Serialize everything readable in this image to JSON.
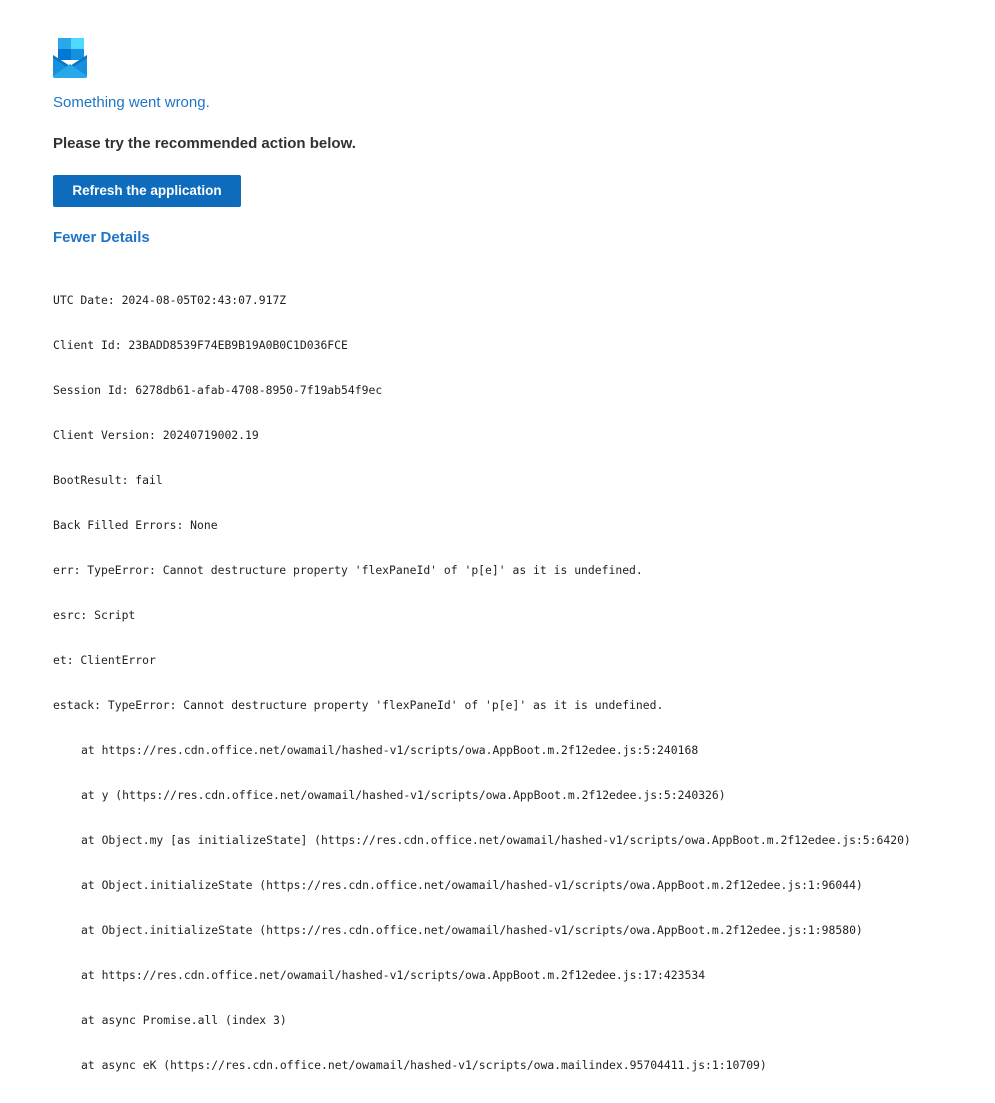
{
  "logo": {
    "icon": "outlook-envelope-icon"
  },
  "headline": "Something went wrong.",
  "subhead": "Please try the recommended action below.",
  "refresh_button": "Refresh the application",
  "details_toggle": "Fewer Details",
  "details": {
    "utc_date": "UTC Date: 2024-08-05T02:43:07.917Z",
    "client_id": "Client Id: 23BADD8539F74EB9B19A0B0C1D036FCE",
    "session_id": "Session Id: 6278db61-afab-4708-8950-7f19ab54f9ec",
    "client_version": "Client Version: 20240719002.19",
    "boot_result": "BootResult: fail",
    "back_filled_errors": "Back Filled Errors: None",
    "err": "err: TypeError: Cannot destructure property 'flexPaneId' of 'p[e]' as it is undefined.",
    "esrc": "esrc: Script",
    "et": "et: ClientError",
    "estack": "estack: TypeError: Cannot destructure property 'flexPaneId' of 'p[e]' as it is undefined.",
    "stack": [
      "at https://res.cdn.office.net/owamail/hashed-v1/scripts/owa.AppBoot.m.2f12edee.js:5:240168",
      "at y (https://res.cdn.office.net/owamail/hashed-v1/scripts/owa.AppBoot.m.2f12edee.js:5:240326)",
      "at Object.my [as initializeState] (https://res.cdn.office.net/owamail/hashed-v1/scripts/owa.AppBoot.m.2f12edee.js:5:6420)",
      "at Object.initializeState (https://res.cdn.office.net/owamail/hashed-v1/scripts/owa.AppBoot.m.2f12edee.js:1:96044)",
      "at Object.initializeState (https://res.cdn.office.net/owamail/hashed-v1/scripts/owa.AppBoot.m.2f12edee.js:1:98580)",
      "at https://res.cdn.office.net/owamail/hashed-v1/scripts/owa.AppBoot.m.2f12edee.js:17:423534",
      "at async Promise.all (index 3)",
      "at async eK (https://res.cdn.office.net/owamail/hashed-v1/scripts/owa.mailindex.95704411.js:1:10709)"
    ]
  },
  "colors": {
    "accent": "#1f75c6",
    "button": "#0f6cbd"
  }
}
